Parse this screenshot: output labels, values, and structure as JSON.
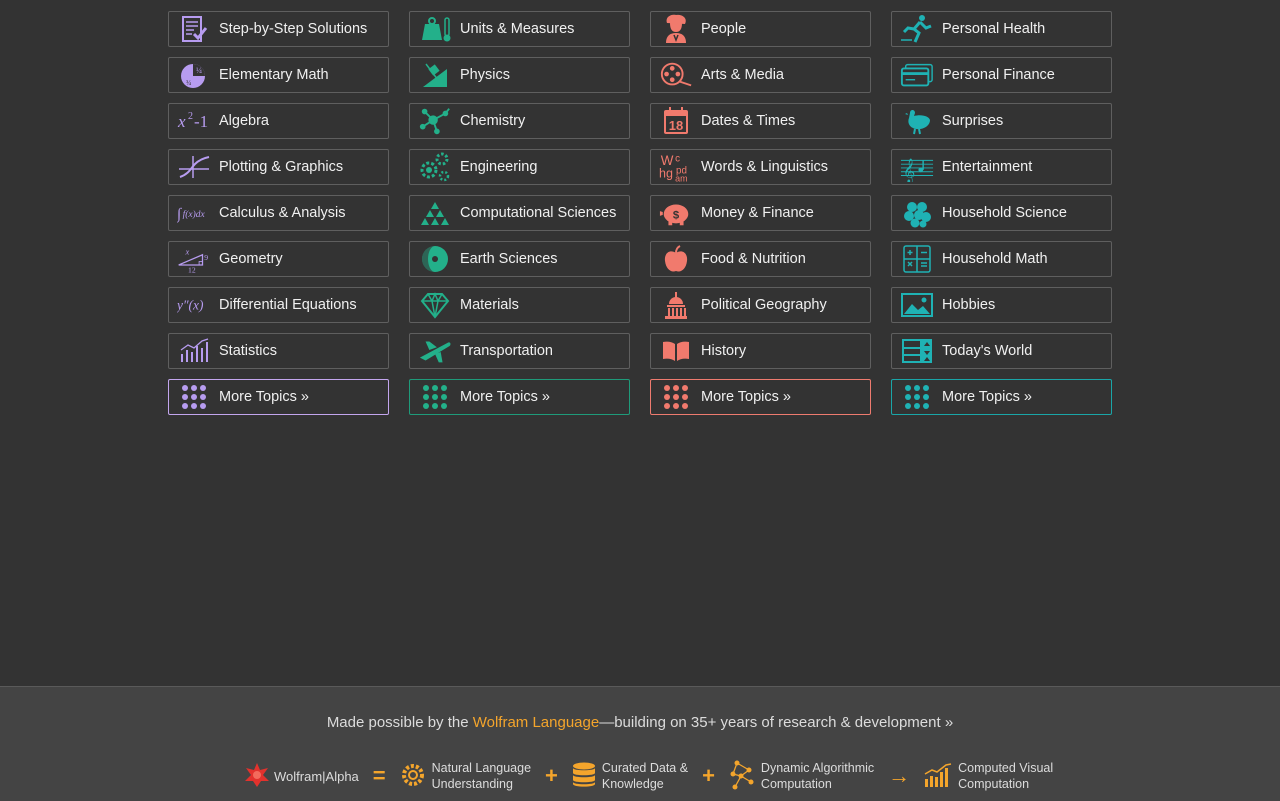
{
  "columns": [
    {
      "accent": "#b79cf0",
      "items": [
        {
          "label": "Step-by-Step Solutions",
          "icon": "step-by-step-icon"
        },
        {
          "label": "Elementary Math",
          "icon": "pie-fraction-icon"
        },
        {
          "label": "Algebra",
          "icon": "x-squared-icon"
        },
        {
          "label": "Plotting & Graphics",
          "icon": "plot-curve-icon"
        },
        {
          "label": "Calculus & Analysis",
          "icon": "integral-icon"
        },
        {
          "label": "Geometry",
          "icon": "triangle-icon"
        },
        {
          "label": "Differential Equations",
          "icon": "y-double-prime-icon"
        },
        {
          "label": "Statistics",
          "icon": "bar-trend-icon"
        }
      ],
      "more": "More Topics »"
    },
    {
      "accent": "#23b08a",
      "items": [
        {
          "label": "Units & Measures",
          "icon": "weight-thermometer-icon"
        },
        {
          "label": "Physics",
          "icon": "incline-plane-icon"
        },
        {
          "label": "Chemistry",
          "icon": "molecule-icon"
        },
        {
          "label": "Engineering",
          "icon": "gears-icon"
        },
        {
          "label": "Computational Sciences",
          "icon": "sierpinski-icon"
        },
        {
          "label": "Earth Sciences",
          "icon": "globe-icon"
        },
        {
          "label": "Materials",
          "icon": "diamond-icon"
        },
        {
          "label": "Transportation",
          "icon": "airplane-icon"
        }
      ],
      "more": "More Topics »"
    },
    {
      "accent": "#f17a6d",
      "items": [
        {
          "label": "People",
          "icon": "portrait-icon"
        },
        {
          "label": "Arts & Media",
          "icon": "film-reel-icon"
        },
        {
          "label": "Dates & Times",
          "icon": "calendar-icon",
          "day": "18"
        },
        {
          "label": "Words & Linguistics",
          "icon": "letters-icon"
        },
        {
          "label": "Money & Finance",
          "icon": "piggy-bank-icon"
        },
        {
          "label": "Food & Nutrition",
          "icon": "apple-icon"
        },
        {
          "label": "Political Geography",
          "icon": "capitol-icon"
        },
        {
          "label": "History",
          "icon": "open-book-icon"
        }
      ],
      "more": "More Topics »"
    },
    {
      "accent": "#1fb2b4",
      "items": [
        {
          "label": "Personal Health",
          "icon": "runner-icon"
        },
        {
          "label": "Personal Finance",
          "icon": "credit-card-icon"
        },
        {
          "label": "Surprises",
          "icon": "chicken-icon"
        },
        {
          "label": "Entertainment",
          "icon": "music-staff-icon"
        },
        {
          "label": "Household Science",
          "icon": "berries-icon"
        },
        {
          "label": "Household Math",
          "icon": "calculator-icon"
        },
        {
          "label": "Hobbies",
          "icon": "picture-icon"
        },
        {
          "label": "Today's World",
          "icon": "stock-board-icon"
        }
      ],
      "more": "More Topics »"
    }
  ],
  "footer": {
    "made_prefix": "Made possible by the ",
    "made_link": "Wolfram Language",
    "made_suffix": "—building on 35+ years of research & development »",
    "brand": "Wolfram|Alpha",
    "equals": "=",
    "plus": "+",
    "arrow": "→",
    "steps": [
      {
        "line1": "Natural Language",
        "line2": "Understanding",
        "icon": "gear-ring-icon"
      },
      {
        "line1": "Curated Data &",
        "line2": "Knowledge",
        "icon": "database-icon"
      },
      {
        "line1": "Dynamic Algorithmic",
        "line2": "Computation",
        "icon": "network-icon"
      },
      {
        "line1": "Computed Visual",
        "line2": "Computation",
        "icon": "bar-chart-icon"
      }
    ]
  }
}
